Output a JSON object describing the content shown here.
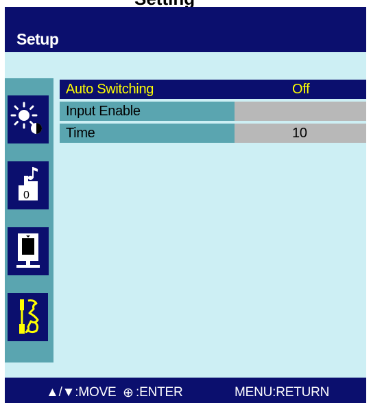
{
  "window": {
    "top_title_fragment": "Setting"
  },
  "header": {
    "title": "Setup"
  },
  "sidebar": {
    "items": [
      {
        "icon": "brightness-contrast-icon",
        "selected": false
      },
      {
        "icon": "audio-icon",
        "selected": false
      },
      {
        "icon": "screen-position-icon",
        "selected": false
      },
      {
        "icon": "setup-tools-icon",
        "selected": true
      }
    ]
  },
  "menu": {
    "rows": [
      {
        "label": "Auto Switching",
        "value": "Off",
        "highlighted": true
      },
      {
        "label": "Input Enable",
        "value": ""
      },
      {
        "label": "Time",
        "value": "10"
      }
    ]
  },
  "footer": {
    "move": "▲/▼:MOVE",
    "enter_symbol": "⊕",
    "enter": ":ENTER",
    "return": "MENU:RETURN"
  },
  "colors": {
    "header_bg": "#0b0f6e",
    "content_bg": "#cdeff4",
    "selection_bg": "#0b0f6e",
    "label_panel_bg": "#5aa5b0",
    "value_panel_bg": "#b8b8b8",
    "highlight_text": "#ffff00"
  }
}
